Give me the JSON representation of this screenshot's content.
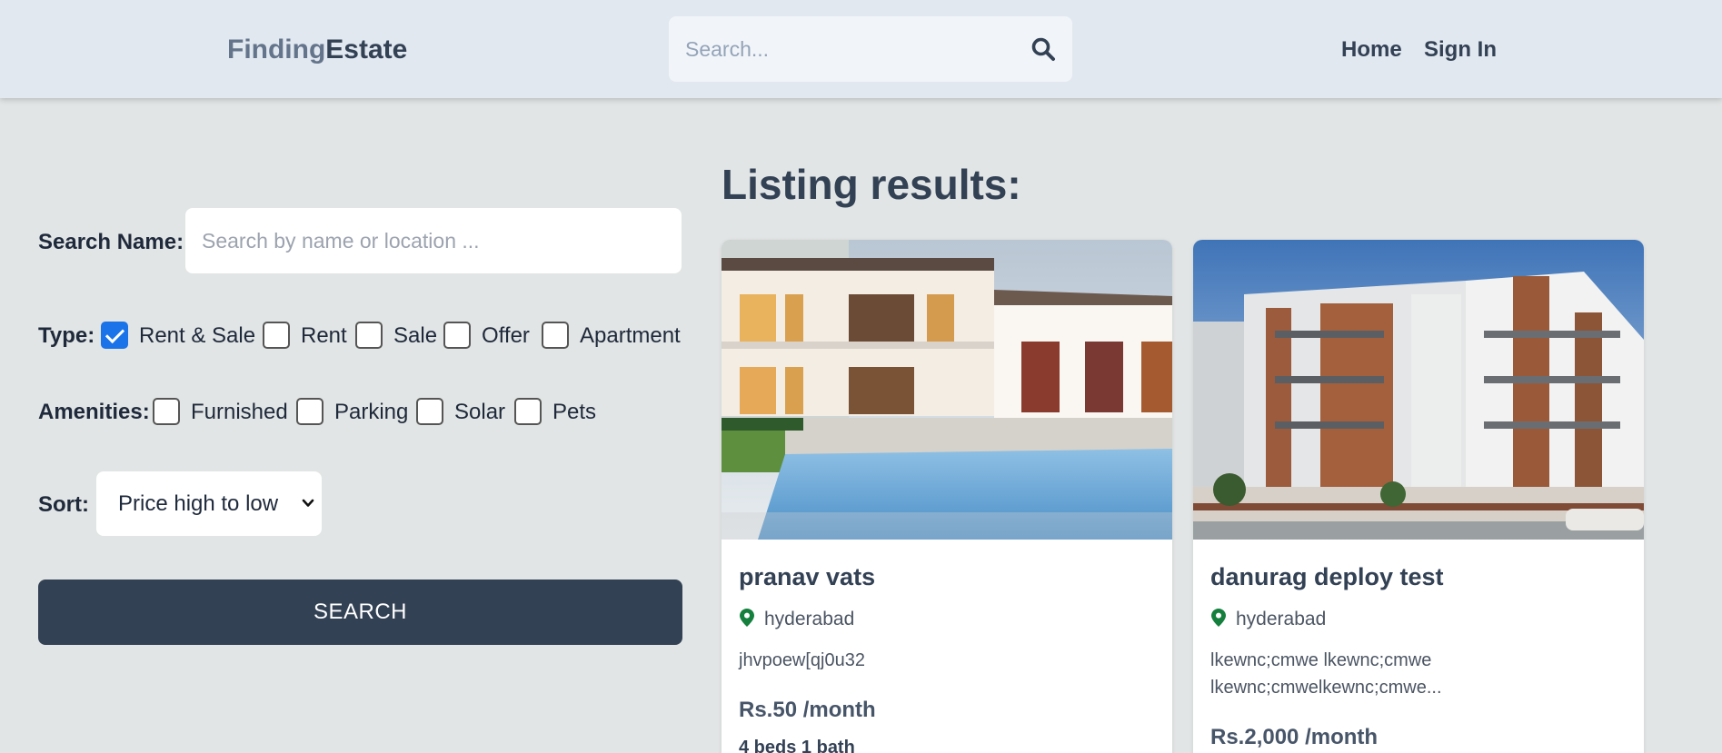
{
  "header": {
    "logo_part1": "Finding",
    "logo_part2": "Estate",
    "search_placeholder": "Search...",
    "search_icon": "magnifier-icon",
    "nav": [
      "Home",
      "Sign In"
    ]
  },
  "filters": {
    "search_label": "Search Name:",
    "search_placeholder": "Search by name or location ...",
    "type_label": "Type:",
    "types": [
      {
        "label": "Rent & Sale",
        "checked": true
      },
      {
        "label": "Rent",
        "checked": false
      },
      {
        "label": "Sale",
        "checked": false
      },
      {
        "label": "Offer",
        "checked": false
      },
      {
        "label": "Apartment",
        "checked": false
      }
    ],
    "amenities_label": "Amenities:",
    "amenities": [
      {
        "label": "Furnished",
        "checked": false
      },
      {
        "label": "Parking",
        "checked": false
      },
      {
        "label": "Solar",
        "checked": false
      },
      {
        "label": "Pets",
        "checked": false
      }
    ],
    "sort_label": "Sort:",
    "sort_value": "Price high to low",
    "search_button": "SEARCH"
  },
  "results": {
    "title": "Listing results:",
    "listings": [
      {
        "title": "pranav vats",
        "location": "hyderabad",
        "description": "jhvpoew[qj0u32",
        "price": "Rs.50 /month",
        "beds_baths": "4 beds 1 bath",
        "image": "villa-with-pool-photo"
      },
      {
        "title": "danurag deploy test",
        "location": "hyderabad",
        "description": "lkewnc;cmwe lkewnc;cmwe lkewnc;cmwelkewnc;cmwe...",
        "price": "Rs.2,000 /month",
        "image": "apartment-building-photo"
      }
    ]
  },
  "colors": {
    "header_bg": "#e2e8f0",
    "page_bg": "#e2e5e5",
    "primary": "#334155",
    "checkbox_accent": "#1a73e8",
    "pin": "#15803d"
  }
}
